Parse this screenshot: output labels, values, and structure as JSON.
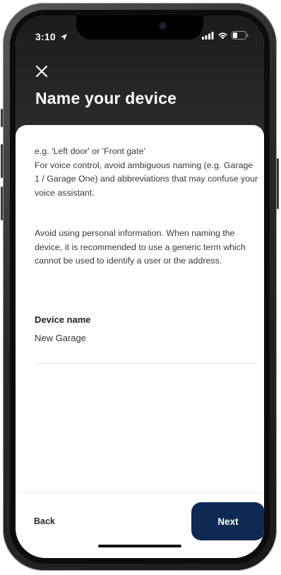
{
  "status_bar": {
    "time": "3:10",
    "location_icon": "location-arrow-icon",
    "signal_icon": "cellular-signal-icon",
    "wifi_icon": "wifi-icon",
    "battery_icon": "battery-icon"
  },
  "header": {
    "close_icon": "close-icon",
    "title": "Name your device"
  },
  "content": {
    "paragraph1_line1": "e.g. 'Left door' or 'Front gate'",
    "paragraph1_line2": "For voice control, avoid ambiguous naming (e.g. Garage 1 / Garage One) and abbreviations that may confuse your voice assistant.",
    "paragraph2": "Avoid using personal information. When naming the device, it is recommended to use a generic term which cannot be used to identify a user or the address.",
    "device_name_label": "Device name",
    "device_name_value": "New Garage"
  },
  "footer": {
    "back_label": "Back",
    "next_label": "Next"
  },
  "colors": {
    "header_bg": "#262626",
    "next_button_bg": "#0f2a52",
    "text": "#3a3a3a"
  }
}
